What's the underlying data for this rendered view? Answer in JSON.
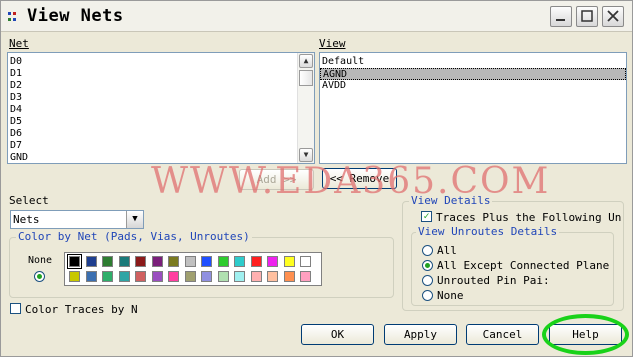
{
  "window": {
    "title": "View Nets",
    "controls": {
      "minimize": "minimize",
      "maximize": "maximize",
      "close": "close"
    }
  },
  "net": {
    "label": "Net",
    "items": [
      "D0",
      "D1",
      "D2",
      "D3",
      "D4",
      "D5",
      "D6",
      "D7",
      "GND"
    ]
  },
  "view": {
    "label": "View",
    "items": [
      "Default",
      "AGND",
      "AVDD"
    ],
    "selected_index": 1
  },
  "buttons": {
    "add": "Add >>",
    "remove": "<< Remove",
    "ok": "OK",
    "apply": "Apply",
    "cancel": "Cancel",
    "help": "Help"
  },
  "select": {
    "label": "Select",
    "value": "Nets"
  },
  "color_by_net": {
    "title": "Color by Net (Pads, Vias, Unroutes)",
    "none_label": "None",
    "selected_swatch": "#000000",
    "row1": [
      "#000000",
      "#1f3f8f",
      "#2e7d32",
      "#1a7a7a",
      "#8b1a1a",
      "#7a1f7a",
      "#7a7a1f",
      "#c0c0c0",
      "#1f4fff",
      "#2ecc2e",
      "#2ecccc",
      "#ff2020",
      "#ee22ee",
      "#ffff20",
      "#ffffff"
    ],
    "row2": [
      "#c8c800",
      "#3b6fb0",
      "#2fae6a",
      "#2fa5a5",
      "#d06060",
      "#9a4fbf",
      "#ff3fa0",
      "#a0a070",
      "#9090e0",
      "#b0e0b0",
      "#a0f0f0",
      "#ffb0b0",
      "#ffc0a0",
      "#ff9050",
      "#ffa0c0"
    ]
  },
  "color_traces": {
    "label": "Color Traces by N",
    "checked": false
  },
  "view_details": {
    "title": "View Details",
    "traces_plus_label": "Traces Plus the Following Unr",
    "traces_plus_checked": true,
    "unroutes": {
      "title": "View Unroutes Details",
      "options": [
        "All",
        "All Except Connected Plane N",
        "Unrouted Pin Pai:",
        "None"
      ],
      "selected_index": 1
    }
  },
  "watermark": "WWW.EDA365.COM",
  "colors": {
    "accent": "#2046b8",
    "help_highlight": "#19d219"
  }
}
